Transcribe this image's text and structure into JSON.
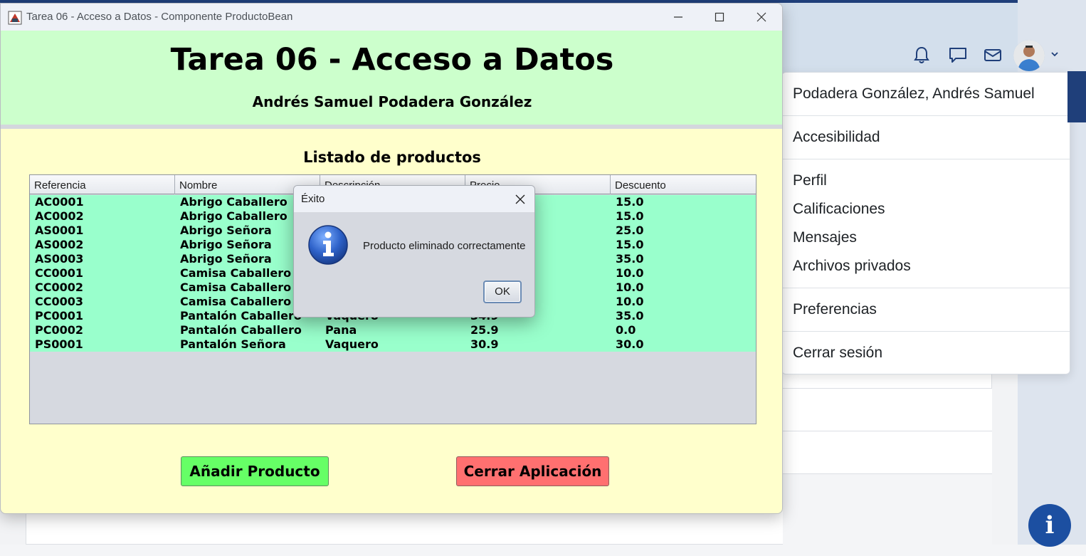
{
  "window": {
    "title": "Tarea 06 - Acceso a Datos - Componente ProductoBean"
  },
  "app": {
    "title": "Tarea 06 - Acceso a Datos",
    "author": "Andrés Samuel Podadera González",
    "list_title": "Listado de productos",
    "add_button": "Añadir Producto",
    "close_button": "Cerrar Aplicación",
    "colors": {
      "header_bg": "#ccffcc",
      "body_bg": "#ffffcc",
      "row_bg": "#99ffcc",
      "add_button": "#66ff66",
      "close_button": "#ff7070"
    }
  },
  "table": {
    "columns": [
      "Referencia",
      "Nombre",
      "Descripción",
      "Precio",
      "Descuento"
    ],
    "rows": [
      {
        "ref": "AC0001",
        "nombre": "Abrigo Caballero",
        "descripcion": "",
        "precio": "",
        "descuento": "15.0"
      },
      {
        "ref": "AC0002",
        "nombre": "Abrigo Caballero",
        "descripcion": "",
        "precio": "",
        "descuento": "15.0"
      },
      {
        "ref": "AS0001",
        "nombre": "Abrigo Señora",
        "descripcion": "",
        "precio": "",
        "descuento": "25.0"
      },
      {
        "ref": "AS0002",
        "nombre": "Abrigo Señora",
        "descripcion": "",
        "precio": "",
        "descuento": "15.0"
      },
      {
        "ref": "AS0003",
        "nombre": "Abrigo Señora",
        "descripcion": "",
        "precio": "",
        "descuento": "35.0"
      },
      {
        "ref": "CC0001",
        "nombre": "Camisa Caballero",
        "descripcion": "",
        "precio": "",
        "descuento": "10.0"
      },
      {
        "ref": "CC0002",
        "nombre": "Camisa Caballero",
        "descripcion": "",
        "precio": "",
        "descuento": "10.0"
      },
      {
        "ref": "CC0003",
        "nombre": "Camisa Caballero",
        "descripcion": "",
        "precio": "",
        "descuento": "10.0"
      },
      {
        "ref": "PC0001",
        "nombre": "Pantalón Caballero",
        "descripcion": "Vaquero",
        "precio": "34.9",
        "descuento": "35.0"
      },
      {
        "ref": "PC0002",
        "nombre": "Pantalón Caballero",
        "descripcion": "Pana",
        "precio": "25.9",
        "descuento": "0.0"
      },
      {
        "ref": "PS0001",
        "nombre": "Pantalón Señora",
        "descripcion": "Vaquero",
        "precio": "30.9",
        "descuento": "30.0"
      }
    ]
  },
  "dialog": {
    "title": "Éxito",
    "message": "Producto eliminado correctamente",
    "ok": "OK",
    "icon": "info-icon"
  },
  "browser": {
    "user_menu": {
      "user_name": "Podadera González, Andrés Samuel",
      "accessibility": "Accesibilidad",
      "items_group": [
        "Perfil",
        "Calificaciones",
        "Mensajes",
        "Archivos privados"
      ],
      "preferences": "Preferencias",
      "logout": "Cerrar sesión"
    },
    "nav_icons": [
      "bell-icon",
      "chat-icon",
      "mail-icon"
    ],
    "accent": "#1f3f7a"
  }
}
